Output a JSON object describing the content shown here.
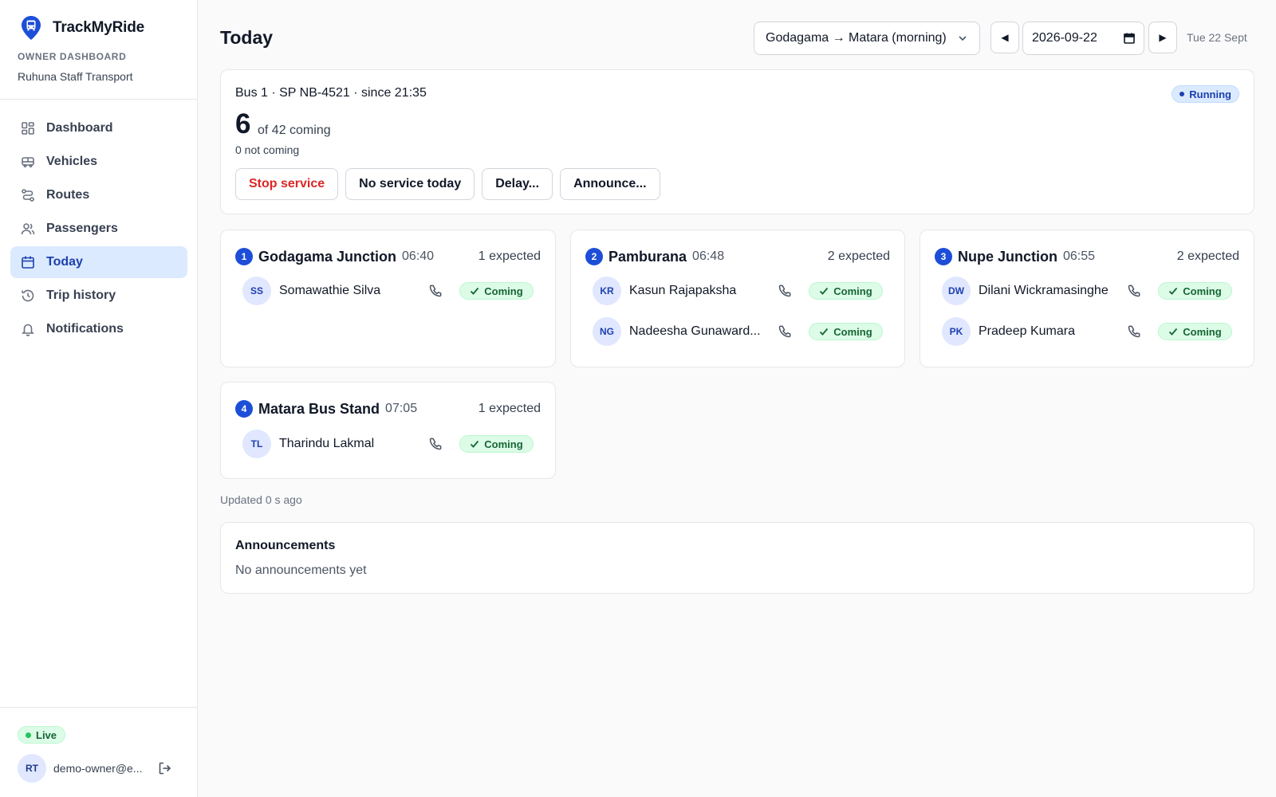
{
  "app": {
    "name": "TrackMyRide",
    "section_label": "OWNER DASHBOARD",
    "org": "Ruhuna Staff Transport"
  },
  "sidebar": {
    "items": [
      {
        "label": "Dashboard",
        "icon": "dashboard-icon"
      },
      {
        "label": "Vehicles",
        "icon": "bus-icon"
      },
      {
        "label": "Routes",
        "icon": "route-icon"
      },
      {
        "label": "Passengers",
        "icon": "users-icon"
      },
      {
        "label": "Today",
        "icon": "calendar-icon",
        "active": true
      },
      {
        "label": "Trip history",
        "icon": "history-icon"
      },
      {
        "label": "Notifications",
        "icon": "bell-icon"
      }
    ],
    "status": "Live",
    "user": {
      "initials": "RT",
      "email": "demo-owner@e..."
    }
  },
  "header": {
    "title": "Today",
    "route_select": "Godagama → Matara (morning)",
    "prev_label": "◀",
    "next_label": "▶",
    "date_value": "2026-09-22",
    "date_label": "Tue 22 Sept"
  },
  "bus": {
    "summary": "Bus 1 · SP NB-4521 · since 21:35",
    "status": "Running",
    "coming": "6",
    "coming_of": "of 42 coming",
    "not_coming": "0 not coming",
    "actions": {
      "stop": "Stop service",
      "no_service": "No service today",
      "delay": "Delay...",
      "announce": "Announce..."
    }
  },
  "stops": [
    {
      "num": "1",
      "name": "Godagama Junction",
      "time": "06:40",
      "expected": "1 expected",
      "passengers": [
        {
          "initials": "SS",
          "name": "Somawathie Silva",
          "status": "Coming"
        }
      ]
    },
    {
      "num": "2",
      "name": "Pamburana",
      "time": "06:48",
      "expected": "2 expected",
      "passengers": [
        {
          "initials": "KR",
          "name": "Kasun Rajapaksha",
          "status": "Coming"
        },
        {
          "initials": "NG",
          "name": "Nadeesha Gunaward...",
          "status": "Coming"
        }
      ]
    },
    {
      "num": "3",
      "name": "Nupe Junction",
      "time": "06:55",
      "expected": "2 expected",
      "passengers": [
        {
          "initials": "DW",
          "name": "Dilani Wickramasinghe",
          "status": "Coming"
        },
        {
          "initials": "PK",
          "name": "Pradeep Kumara",
          "status": "Coming"
        }
      ]
    },
    {
      "num": "4",
      "name": "Matara Bus Stand",
      "time": "07:05",
      "expected": "1 expected",
      "passengers": [
        {
          "initials": "TL",
          "name": "Tharindu Lakmal",
          "status": "Coming"
        }
      ]
    }
  ],
  "updated": "Updated 0 s ago",
  "announcements": {
    "title": "Announcements",
    "empty": "No announcements yet"
  },
  "colors": {
    "primary": "#1d4ed8",
    "active_bg": "#dbeafe",
    "success_bg": "#dcfce7",
    "success_text": "#166534",
    "danger": "#dc2626"
  }
}
